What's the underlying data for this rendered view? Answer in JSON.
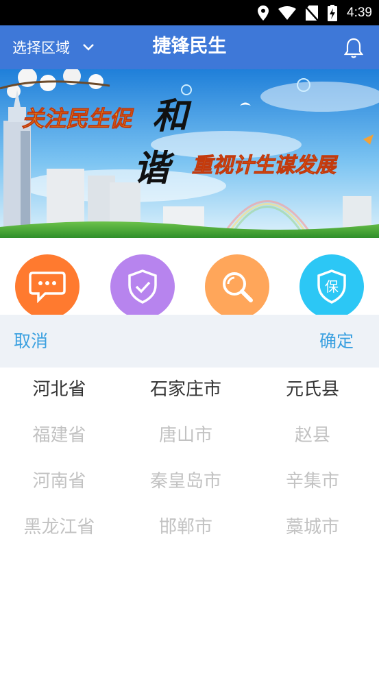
{
  "status_bar": {
    "time": "4:39"
  },
  "app_bar": {
    "region_label": "选择区域",
    "title": "捷锋民生"
  },
  "banner": {
    "text_left": "关注民生促",
    "text_he": "和",
    "text_xie": "谐",
    "text_right": "重视计生谋发展"
  },
  "features": [
    {
      "icon": "message-icon",
      "color": "#ff7a2f"
    },
    {
      "icon": "shield-check-icon",
      "color": "#b784ee"
    },
    {
      "icon": "search-icon",
      "color": "#ffa65a"
    },
    {
      "icon": "insurance-icon",
      "color": "#2cc7f5",
      "glyph": "保"
    }
  ],
  "picker": {
    "cancel_label": "取消",
    "confirm_label": "确定",
    "provinces": [
      "河北省",
      "福建省",
      "河南省",
      "黑龙江省"
    ],
    "cities": [
      "石家庄市",
      "唐山市",
      "秦皇岛市",
      "邯郸市"
    ],
    "counties": [
      "元氏县",
      "赵县",
      "辛集市",
      "藁城市"
    ],
    "selected": {
      "province": "河北省",
      "city": "石家庄市",
      "county": "元氏县"
    }
  }
}
